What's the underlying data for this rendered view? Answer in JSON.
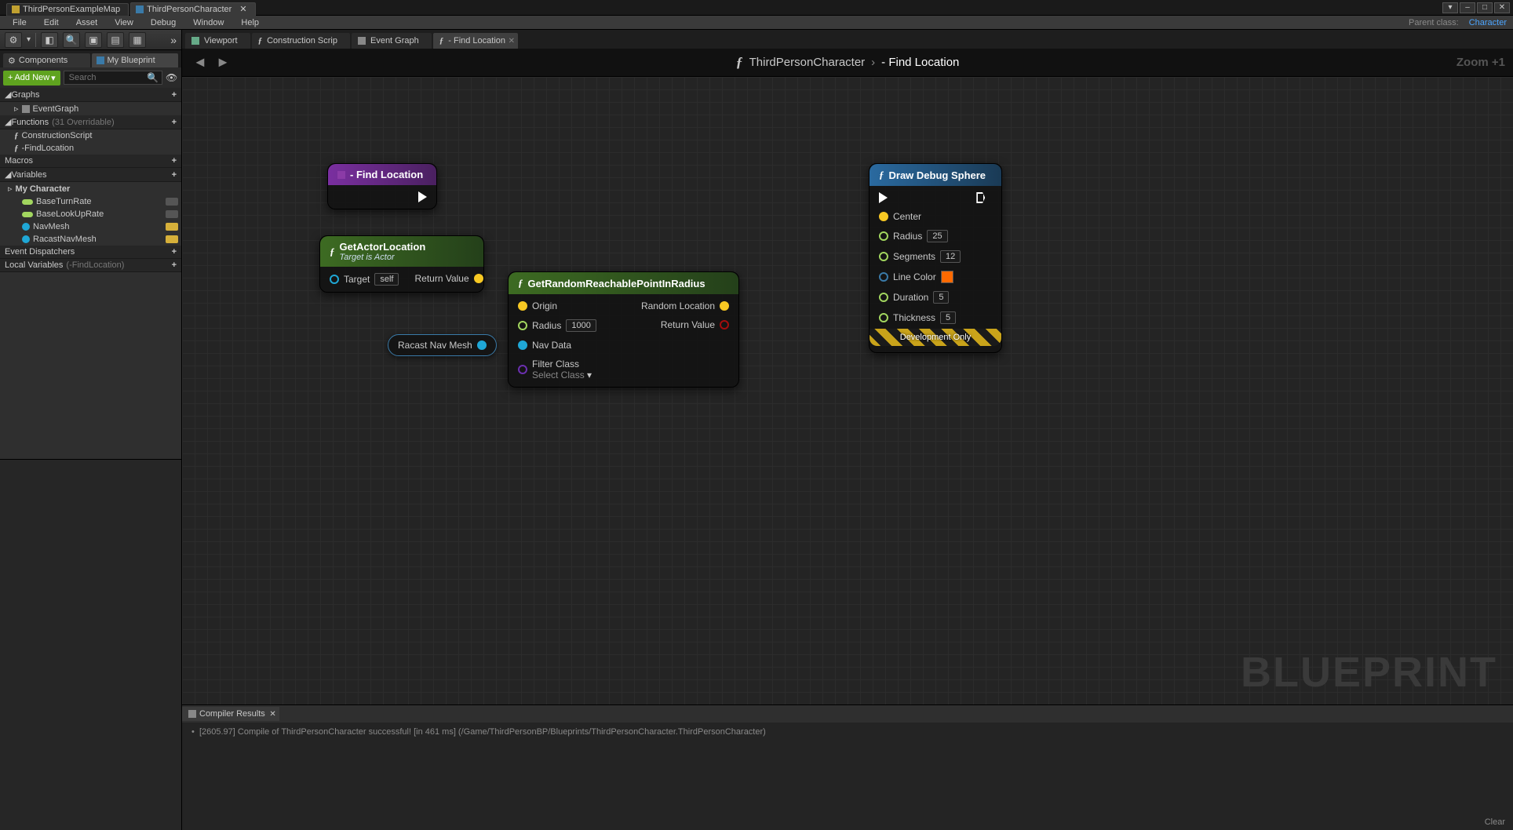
{
  "window": {
    "tabs": [
      {
        "label": "ThirdPersonExampleMap"
      },
      {
        "label": "ThirdPersonCharacter"
      }
    ],
    "controls": {
      "min": "–",
      "max": "□",
      "close": "✕",
      "extra": "▾"
    }
  },
  "menu": {
    "items": [
      "File",
      "Edit",
      "Asset",
      "View",
      "Debug",
      "Window",
      "Help"
    ],
    "right_label": "Parent class:",
    "right_link": "Character"
  },
  "editor_tabs": [
    {
      "icon": "viewport-icon",
      "label": "Viewport"
    },
    {
      "icon": "f-icon",
      "label": "Construction Scrip"
    },
    {
      "icon": "graph-icon",
      "label": "Event Graph"
    },
    {
      "icon": "f-icon",
      "label": "- Find Location",
      "active": true
    }
  ],
  "sidebar": {
    "tabs": {
      "components": "Components",
      "blueprint": "My Blueprint"
    },
    "add_label": "Add New",
    "search_placeholder": "Search",
    "sections": {
      "graphs": {
        "title": "Graphs",
        "items": [
          {
            "label": "EventGraph"
          }
        ]
      },
      "functions": {
        "title": "Functions",
        "note": "(31 Overridable)",
        "items": [
          {
            "label": "ConstructionScript"
          },
          {
            "label": "-FindLocation"
          }
        ]
      },
      "macros": {
        "title": "Macros"
      },
      "variables": {
        "title": "Variables",
        "group": "My Character",
        "items": [
          {
            "label": "BaseTurnRate",
            "color": "#a2d65f",
            "eye": false
          },
          {
            "label": "BaseLookUpRate",
            "color": "#a2d65f",
            "eye": false
          },
          {
            "label": "NavMesh",
            "color": "#1fa7d6",
            "eye": true
          },
          {
            "label": "RacastNavMesh",
            "color": "#1fa7d6",
            "eye": true
          }
        ]
      },
      "dispatchers": {
        "title": "Event Dispatchers"
      },
      "locals": {
        "title": "Local Variables",
        "note": "(-FindLocation)"
      }
    }
  },
  "breadcrumb": {
    "asset": "ThirdPersonCharacter",
    "func": "- Find Location"
  },
  "zoom_label": "Zoom +1",
  "watermark": "BLUEPRINT",
  "nodes": {
    "entry": {
      "title": "- Find Location"
    },
    "getactor": {
      "title": "GetActorLocation",
      "sub": "Target is Actor",
      "in": [
        {
          "label": "Target",
          "val": "self"
        }
      ],
      "out": [
        {
          "label": "Return Value"
        }
      ]
    },
    "varnode": {
      "label": "Racast Nav Mesh"
    },
    "getrandom": {
      "title": "GetRandomReachablePointInRadius",
      "in": [
        {
          "label": "Origin"
        },
        {
          "label": "Radius",
          "val": "1000"
        },
        {
          "label": "Nav Data"
        },
        {
          "label": "Filter Class",
          "sub": "Select Class"
        }
      ],
      "out": [
        {
          "label": "Random Location"
        },
        {
          "label": "Return Value"
        }
      ]
    },
    "drawdebug": {
      "title": "Draw Debug Sphere",
      "in": [
        {
          "label": "Center"
        },
        {
          "label": "Radius",
          "val": "25"
        },
        {
          "label": "Segments",
          "val": "12"
        },
        {
          "label": "Line Color",
          "color": "#ff6a00"
        },
        {
          "label": "Duration",
          "val": "5"
        },
        {
          "label": "Thickness",
          "val": "5"
        }
      ],
      "footer": "Development Only"
    }
  },
  "results": {
    "tab": "Compiler Results",
    "line": "[2605.97] Compile of ThirdPersonCharacter successful! [in 461 ms] (/Game/ThirdPersonBP/Blueprints/ThirdPersonCharacter.ThirdPersonCharacter)",
    "clear": "Clear"
  }
}
